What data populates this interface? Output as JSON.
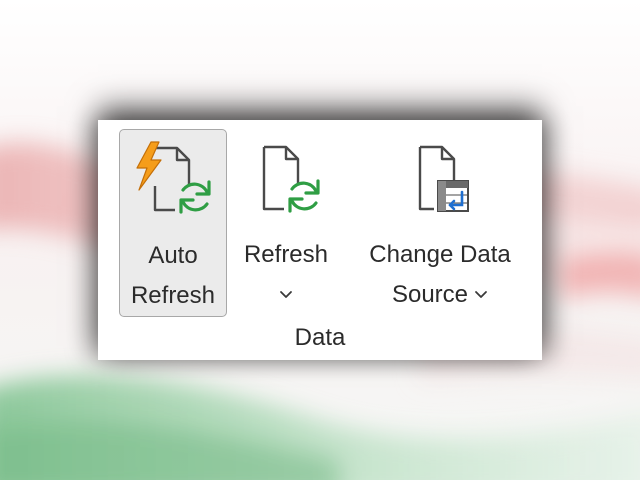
{
  "ribbon": {
    "group_label": "Data",
    "buttons": {
      "auto_refresh": {
        "line1": "Auto",
        "line2": "Refresh"
      },
      "refresh": {
        "line1": "Refresh"
      },
      "change_data_source": {
        "line1": "Change Data",
        "line2": "Source"
      }
    }
  },
  "icons": {
    "auto_refresh": "lightning-document-refresh-icon",
    "refresh": "document-refresh-icon",
    "change_data_source": "document-table-icon",
    "dropdown": "chevron-down-icon"
  },
  "colors": {
    "lightning": "#f59d1a",
    "refresh_green": "#2f9e44",
    "table_blue": "#1f6fd0",
    "pressed_bg": "#ebebeb"
  }
}
